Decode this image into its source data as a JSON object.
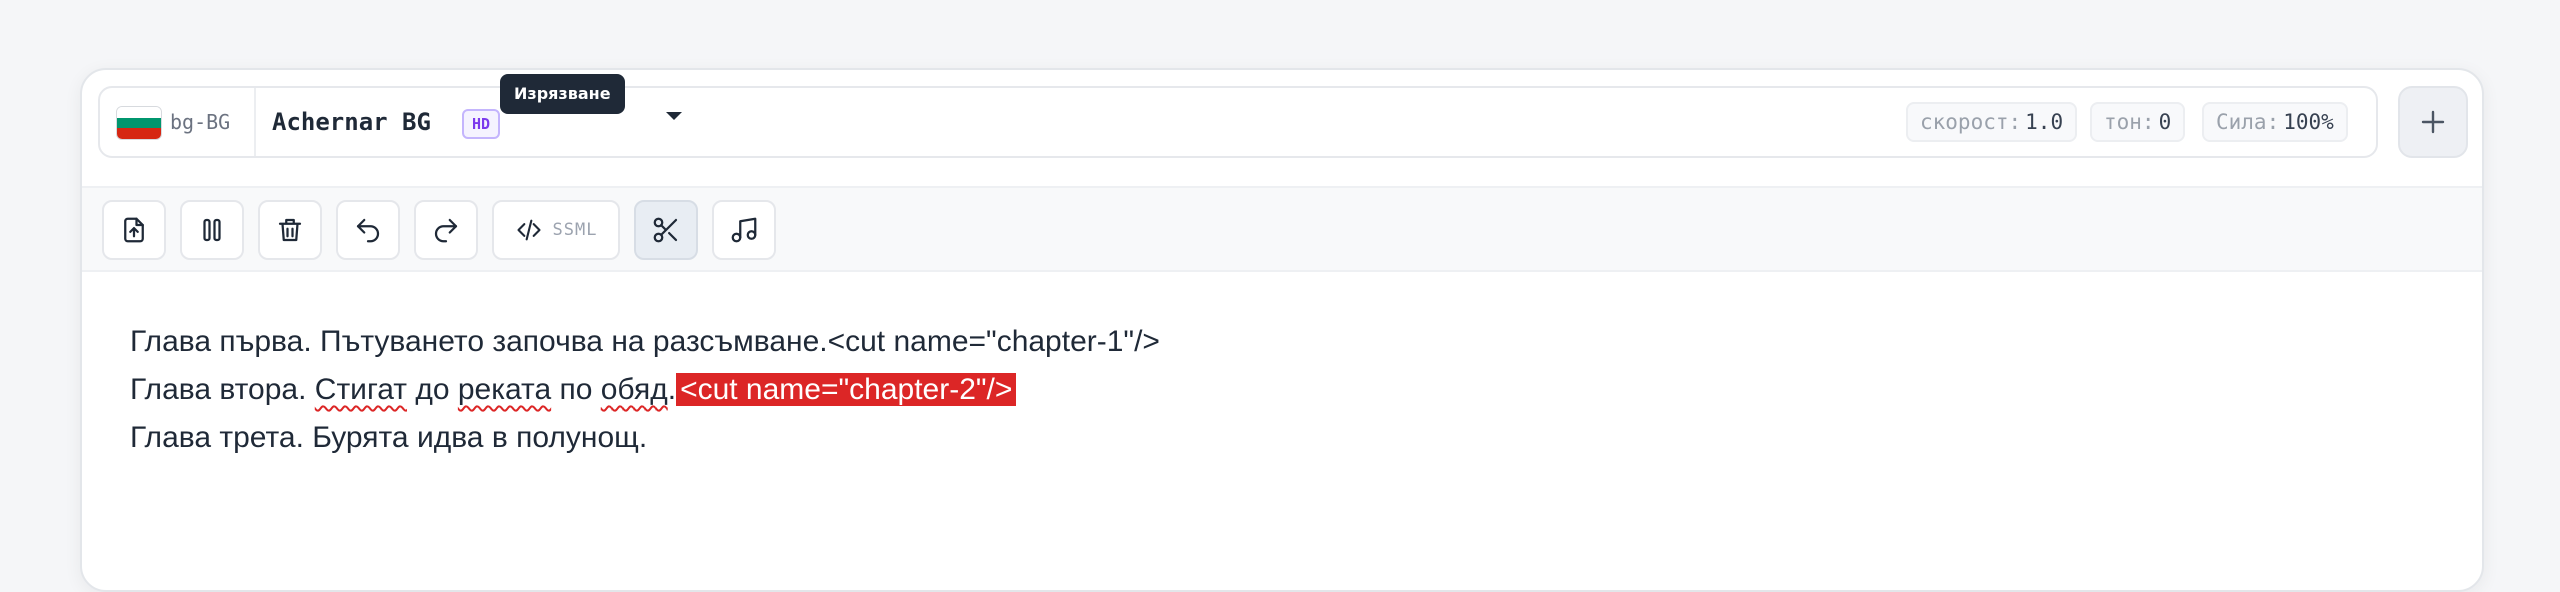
{
  "header": {
    "lang_code": "bg-BG",
    "voice_name": "Achernar BG",
    "quality_badge": "HD",
    "params": [
      {
        "key": "скорост:",
        "value": "1.0"
      },
      {
        "key": "тон:",
        "value": "0"
      },
      {
        "key": "Сила:",
        "value": "100%"
      }
    ],
    "add_icon": "plus-icon"
  },
  "toolbar": {
    "ssml_label": "SSML",
    "tooltip": "Изрязване",
    "icons": [
      "file-upload-icon",
      "pause-icon",
      "trash-icon",
      "undo-icon",
      "redo-icon",
      "code-icon",
      "scissors-icon",
      "music-note-icon"
    ]
  },
  "editor": {
    "line1": "Глава първа. Пътуването започва на разсъмване.<cut name=\"chapter-1\"/>",
    "line2_pre": "Глава втора. ",
    "line2_w1": "Стигат",
    "line2_sp1": " до ",
    "line2_w2": "реката",
    "line2_sp2": " по ",
    "line2_w3": "обяд",
    "line2_dot": ".",
    "line2_tag": "<cut name=\"chapter-2\"/>",
    "line3": "Глава трета. Бурята идва в полунощ."
  },
  "colors": {
    "highlight": "#dc2626",
    "hd_badge": "#7c3aed",
    "tooltip_bg": "#1f2937"
  }
}
